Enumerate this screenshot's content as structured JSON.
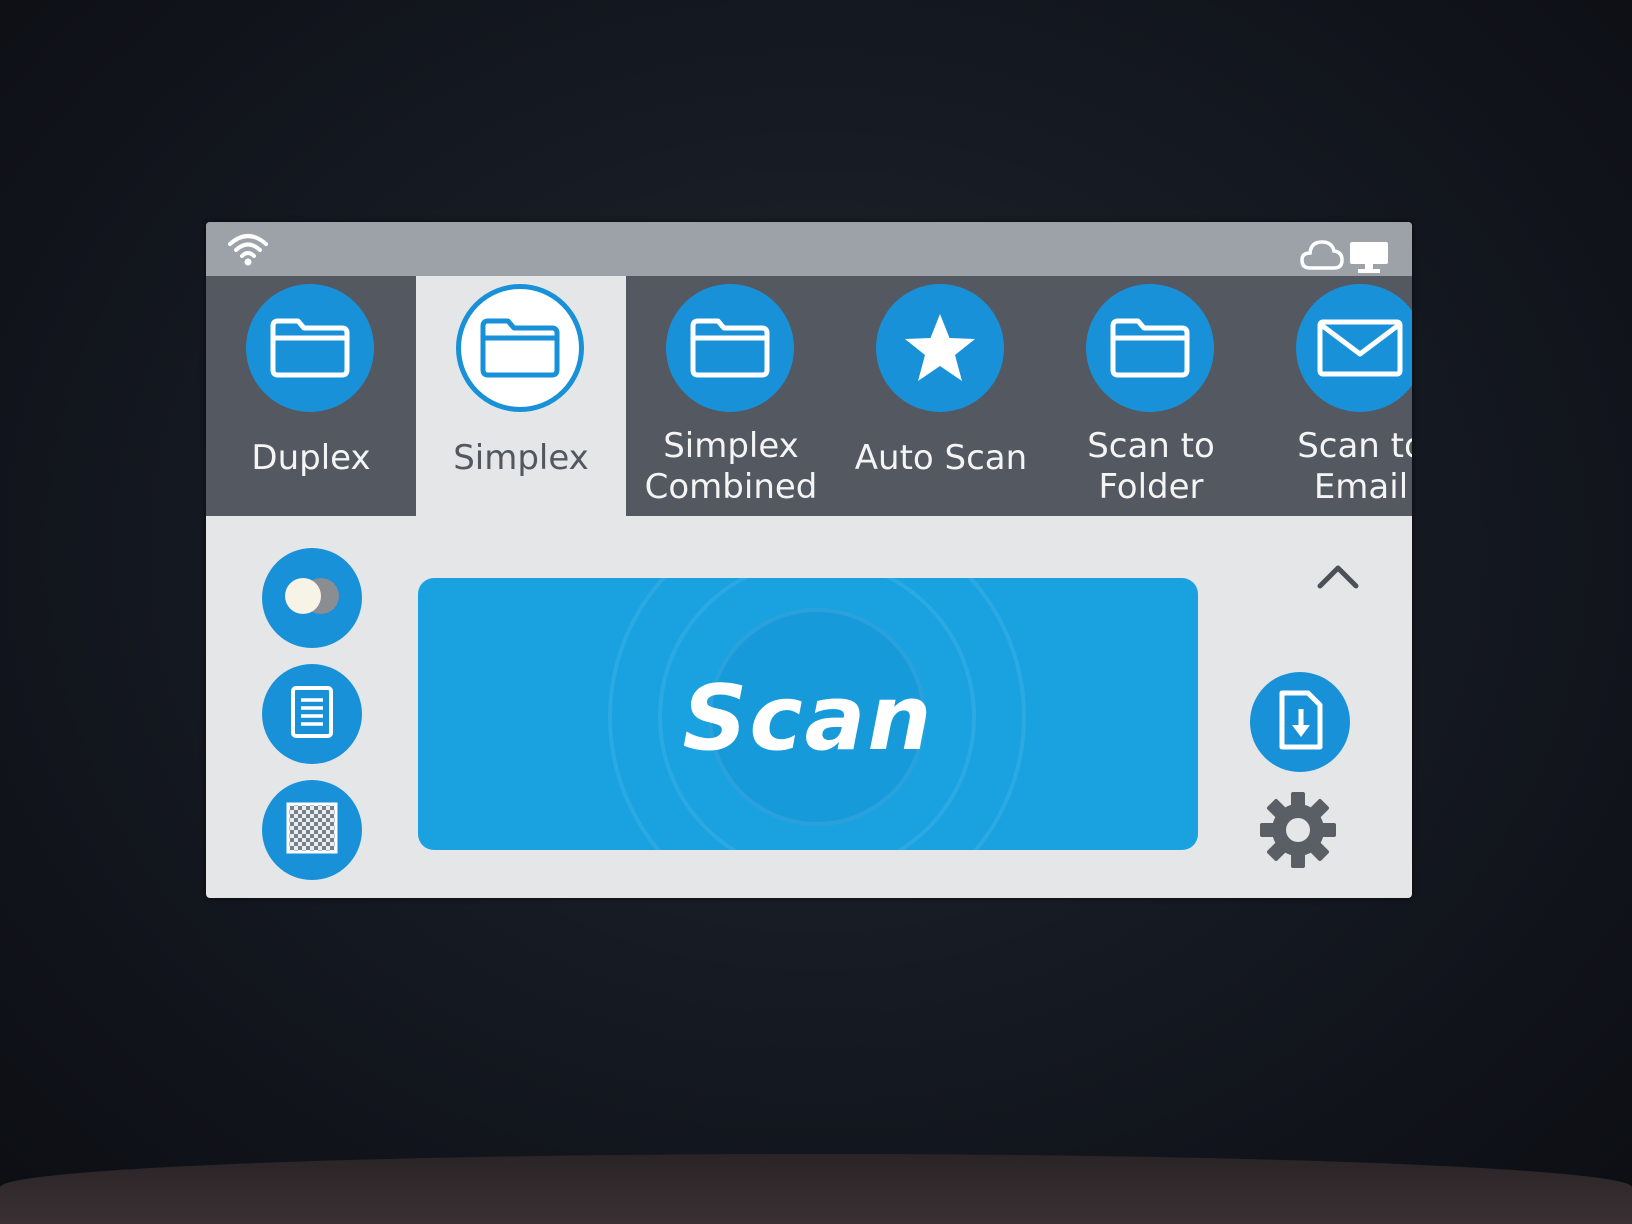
{
  "tabs": [
    {
      "label": "Duplex",
      "icon": "folder-icon",
      "selected": false
    },
    {
      "label": "Simplex",
      "icon": "folder-icon",
      "selected": true
    },
    {
      "label": "Simplex\nCombined",
      "icon": "folder-icon",
      "selected": false
    },
    {
      "label": "Auto Scan",
      "icon": "star-icon",
      "selected": false
    },
    {
      "label": "Scan to\nFolder",
      "icon": "folder-icon",
      "selected": false
    },
    {
      "label": "Scan to\nEmail",
      "icon": "envelope-icon",
      "selected": false
    }
  ],
  "scan_button": {
    "label": "Scan"
  },
  "colors": {
    "accent": "#1991d9",
    "scan_button": "#1aa2e0",
    "tab_bar": "#535861",
    "status_bar": "#9da2a8",
    "panel": "#e4e6e8"
  }
}
